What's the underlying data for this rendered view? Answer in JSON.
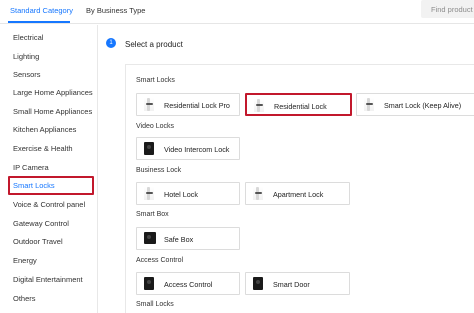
{
  "tabs": [
    {
      "label": "Standard Category"
    },
    {
      "label": "By Business Type"
    }
  ],
  "search": {
    "placeholder": "Find product s"
  },
  "sidebar": {
    "items": [
      {
        "label": "Electrical"
      },
      {
        "label": "Lighting"
      },
      {
        "label": "Sensors"
      },
      {
        "label": "Large Home Appliances"
      },
      {
        "label": "Small Home Appliances"
      },
      {
        "label": "Kitchen Appliances"
      },
      {
        "label": "Exercise & Health"
      },
      {
        "label": "IP Camera"
      },
      {
        "label": "Smart Locks"
      },
      {
        "label": "Voice & Control panel"
      },
      {
        "label": "Gateway Control"
      },
      {
        "label": "Outdoor Travel"
      },
      {
        "label": "Energy"
      },
      {
        "label": "Digital Entertainment"
      },
      {
        "label": "Others"
      }
    ],
    "selected": "Smart Locks"
  },
  "step": {
    "number": "1",
    "title": "Select a product"
  },
  "groups": [
    {
      "title": "Smart Locks",
      "products": [
        {
          "label": "Residential Lock Pro",
          "icon": "lock-product-icon"
        },
        {
          "label": "Residential Lock",
          "icon": "lock-product-icon"
        },
        {
          "label": "Smart Lock (Keep Alive)",
          "icon": "lock-product-icon"
        }
      ]
    },
    {
      "title": "Video Locks",
      "products": [
        {
          "label": "Video Intercom Lock",
          "icon": "intercom-lock-icon"
        }
      ]
    },
    {
      "title": "Business Lock",
      "products": [
        {
          "label": "Hotel Lock",
          "icon": "lock-product-icon"
        },
        {
          "label": "Apartment Lock",
          "icon": "lock-product-icon"
        }
      ]
    },
    {
      "title": "Smart Box",
      "products": [
        {
          "label": "Safe Box",
          "icon": "safe-box-icon"
        }
      ]
    },
    {
      "title": "Access Control",
      "products": [
        {
          "label": "Access Control",
          "icon": "access-control-icon"
        },
        {
          "label": "Smart Door",
          "icon": "smart-door-icon"
        }
      ]
    },
    {
      "title": "Small Locks",
      "products": []
    }
  ],
  "selected_product": "Residential Lock",
  "colors": {
    "accent": "#1677ff",
    "highlight": "#c2182c"
  }
}
